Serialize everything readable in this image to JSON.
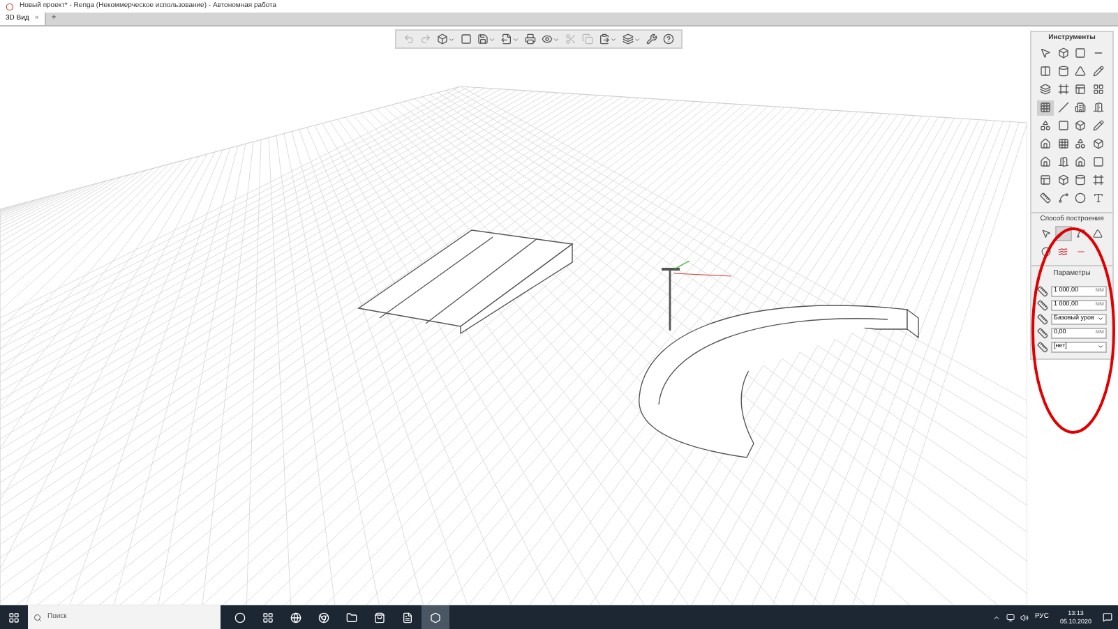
{
  "window": {
    "title": "Новый проект* - Renga (Некоммерческое использование) - Автономная работа"
  },
  "tabs": [
    {
      "label": "3D Вид",
      "selected": true,
      "close": "×"
    }
  ],
  "new_tab": "+",
  "toolbar": [
    {
      "disabled": true,
      "dropdown": false
    },
    {
      "disabled": true,
      "dropdown": false
    },
    {
      "disabled": false,
      "dropdown": true
    },
    {
      "disabled": false,
      "dropdown": false
    },
    {
      "disabled": false,
      "dropdown": true
    },
    {
      "disabled": false,
      "dropdown": true
    },
    {
      "disabled": false,
      "dropdown": false
    },
    {
      "disabled": false,
      "dropdown": true
    },
    {
      "disabled": true,
      "dropdown": false
    },
    {
      "disabled": true,
      "dropdown": false
    },
    {
      "disabled": false,
      "dropdown": true
    },
    {
      "disabled": false,
      "dropdown": true
    },
    {
      "disabled": false,
      "dropdown": false
    },
    {
      "disabled": false,
      "dropdown": false
    }
  ],
  "tools": {
    "title": "Инструменты",
    "items": [
      {
        "selected": false
      },
      {
        "selected": false
      },
      {
        "selected": false
      },
      {
        "selected": false
      },
      {
        "selected": false
      },
      {
        "selected": false
      },
      {
        "selected": false
      },
      {
        "selected": false
      },
      {
        "selected": false
      },
      {
        "selected": false
      },
      {
        "selected": false
      },
      {
        "selected": false
      },
      {
        "selected": true
      },
      {
        "selected": false
      },
      {
        "selected": false
      },
      {
        "selected": false
      },
      {
        "selected": false
      },
      {
        "selected": false
      },
      {
        "selected": false
      },
      {
        "selected": false
      },
      {
        "selected": false
      },
      {
        "selected": false
      },
      {
        "selected": false
      },
      {
        "selected": false
      },
      {
        "selected": false
      },
      {
        "selected": false
      },
      {
        "selected": false
      },
      {
        "selected": false
      },
      {
        "selected": false
      },
      {
        "selected": false
      },
      {
        "selected": false
      },
      {
        "selected": false
      },
      {
        "selected": false
      },
      {
        "selected": false
      },
      {
        "selected": false
      },
      {
        "selected": false
      }
    ]
  },
  "construction": {
    "title": "Способ построения",
    "items": [
      {
        "selected": false
      },
      {
        "selected": true
      },
      {
        "selected": false
      },
      {
        "selected": false
      },
      {
        "selected": false
      },
      {
        "selected": false
      },
      {
        "selected": false
      }
    ]
  },
  "parameters": {
    "title": "Параметры",
    "fields": [
      {
        "kind": "number",
        "value": "1 000,00",
        "unit": "мм"
      },
      {
        "kind": "number",
        "value": "1 000,00",
        "unit": "мм"
      },
      {
        "kind": "select",
        "value": "Базовый уров"
      },
      {
        "kind": "number",
        "value": "0,00",
        "unit": "мм"
      },
      {
        "kind": "select",
        "value": "[нет]"
      }
    ]
  },
  "taskbar": {
    "search_placeholder": "Поиск",
    "apps": [
      {
        "active": false
      },
      {
        "active": false
      },
      {
        "active": false
      },
      {
        "active": false
      },
      {
        "active": false
      },
      {
        "active": false
      },
      {
        "active": false
      },
      {
        "active": true
      }
    ],
    "language": "РУС",
    "time": "13:13",
    "date": "05.10.2020"
  }
}
